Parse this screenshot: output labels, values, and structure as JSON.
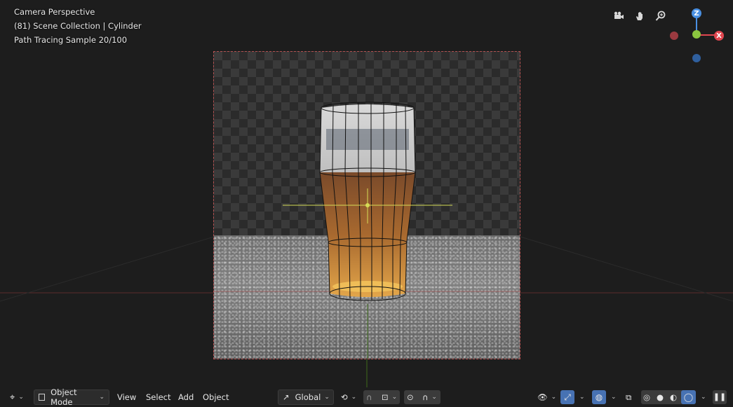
{
  "overlay": {
    "view_name": "Camera Perspective",
    "collection": "(81) Scene Collection | Cylinder",
    "render_status": "Path Tracing Sample 20/100"
  },
  "navigation": {
    "icons": [
      "camera-icon",
      "hand-pan-icon",
      "zoom-icon"
    ],
    "axes": {
      "z_label": "Z",
      "x_label": "X",
      "colors": {
        "x": "#e0464f",
        "y": "#8bc53f",
        "z": "#4a90e2",
        "x_neg": "#9b3a40",
        "z_neg": "#2f5f9e"
      }
    }
  },
  "header": {
    "editor_type_icon": "transform-gizmo-icon",
    "mode": "Object Mode",
    "menus": {
      "view": "View",
      "select": "Select",
      "add": "Add",
      "object": "Object"
    },
    "orientation": "Global",
    "pivot_icon": "pivot-icon",
    "snap_icon": "magnet-icon",
    "proportional_icon": "proportional-edit-icon",
    "viewport_shading": "rendered"
  },
  "colors": {
    "accent": "#4772b3",
    "frame_border": "#b25050",
    "background": "#1d1d1d",
    "header_bg": "#1d1d1d"
  }
}
